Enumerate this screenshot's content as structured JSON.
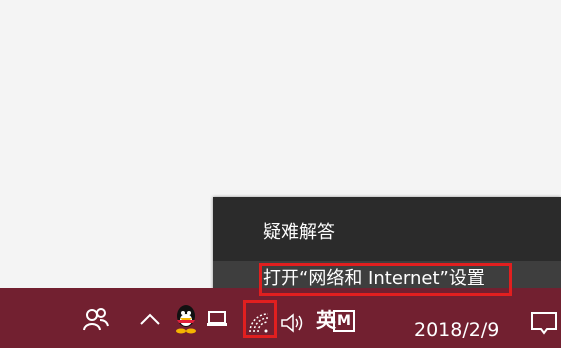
{
  "context_menu": {
    "items": [
      {
        "label": "疑难解答"
      },
      {
        "label": "打开“网络和 Internet”设置"
      }
    ]
  },
  "taskbar": {
    "language_label": "英",
    "ime_label": "M",
    "date": "2018/2/9",
    "icons": [
      "people-icon",
      "chevron-up-icon",
      "qq-icon",
      "device-icon",
      "network-icon",
      "volume-icon",
      "notification-icon"
    ]
  },
  "colors": {
    "taskbar": "#722030",
    "menu_background": "#2b2b2b",
    "menu_hover": "#3e3e3e",
    "highlight": "#e11f1f"
  }
}
